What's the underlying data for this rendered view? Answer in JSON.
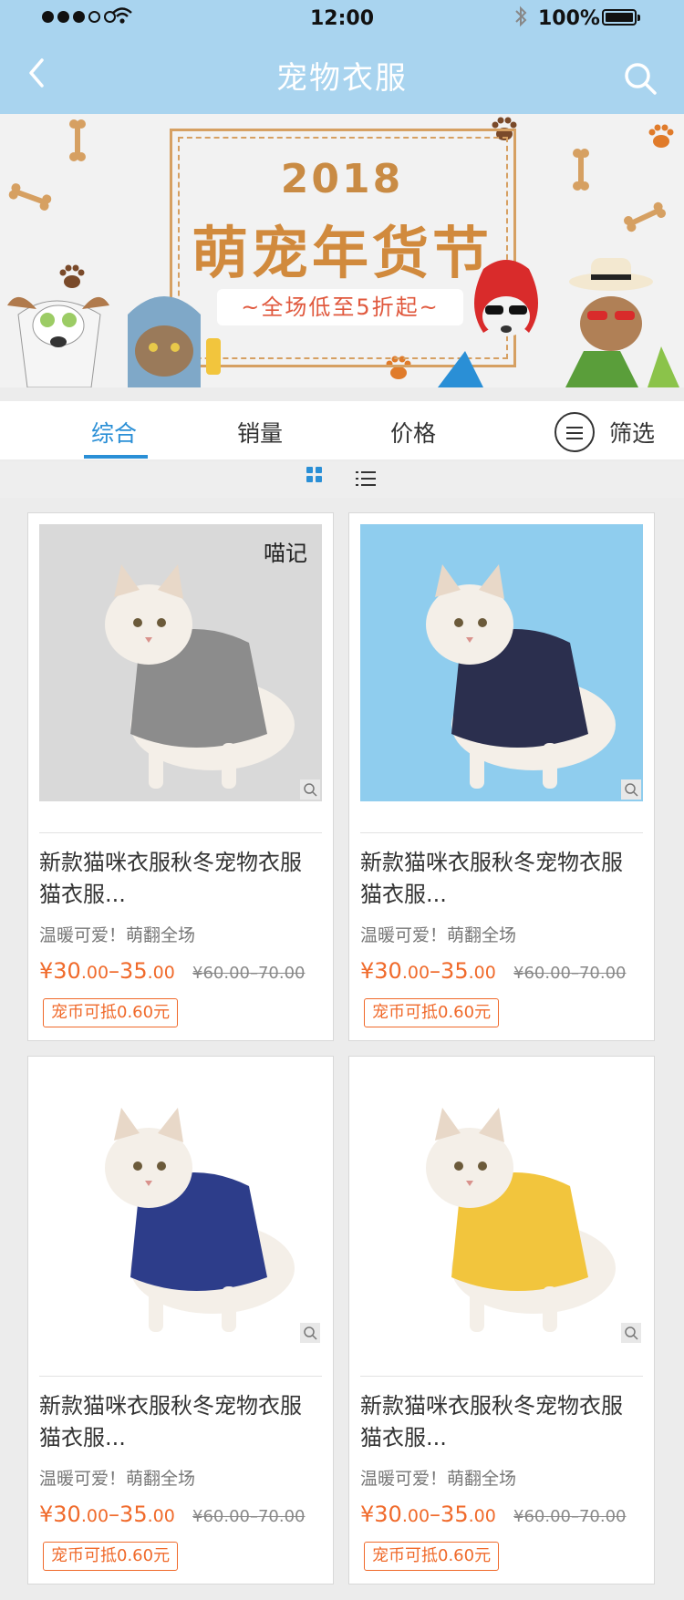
{
  "status_bar": {
    "time": "12:00",
    "battery": "100%"
  },
  "nav": {
    "title": "宠物衣服"
  },
  "banner": {
    "year": "2018",
    "title": "萌宠年货节",
    "subtitle": "~全场低至5折起~"
  },
  "sort_tabs": [
    {
      "label": "综合",
      "active": true
    },
    {
      "label": "销量",
      "active": false
    },
    {
      "label": "价格",
      "active": false
    }
  ],
  "filter": {
    "label": "筛选"
  },
  "products": [
    {
      "name": "新款猫咪衣服秋冬宠物衣服猫衣服...",
      "desc": "温暖可爱！萌翻全场",
      "price_symbol": "¥",
      "price_a": "30",
      "price_a_dec": ".00",
      "price_sep": "–",
      "price_b": "35",
      "price_b_dec": ".00",
      "old_price": "¥60.00–70.00",
      "coin": "宠币可抵0.60元",
      "photo_bg": "#d9d9d9",
      "garment_color": "#8c8c8c",
      "watermark": "喵记"
    },
    {
      "name": "新款猫咪衣服秋冬宠物衣服猫衣服...",
      "desc": "温暖可爱！萌翻全场",
      "price_symbol": "¥",
      "price_a": "30",
      "price_a_dec": ".00",
      "price_sep": "–",
      "price_b": "35",
      "price_b_dec": ".00",
      "old_price": "¥60.00–70.00",
      "coin": "宠币可抵0.60元",
      "photo_bg": "#8fcdee",
      "garment_color": "#2b2f4e"
    },
    {
      "name": "新款猫咪衣服秋冬宠物衣服猫衣服...",
      "desc": "温暖可爱！萌翻全场",
      "price_symbol": "¥",
      "price_a": "30",
      "price_a_dec": ".00",
      "price_sep": "–",
      "price_b": "35",
      "price_b_dec": ".00",
      "old_price": "¥60.00–70.00",
      "coin": "宠币可抵0.60元",
      "photo_bg": "#ffffff",
      "garment_color": "#2d3d8a"
    },
    {
      "name": "新款猫咪衣服秋冬宠物衣服猫衣服...",
      "desc": "温暖可爱！萌翻全场",
      "price_symbol": "¥",
      "price_a": "30",
      "price_a_dec": ".00",
      "price_sep": "–",
      "price_b": "35",
      "price_b_dec": ".00",
      "old_price": "¥60.00–70.00",
      "coin": "宠币可抵0.60元",
      "photo_bg": "#ffffff",
      "garment_color": "#f2c53d"
    }
  ],
  "colors": {
    "header_bg": "#a9d4ef",
    "accent_blue": "#2a8fd6",
    "price_orange": "#f06a2b",
    "banner_brown": "#d18a3d"
  }
}
